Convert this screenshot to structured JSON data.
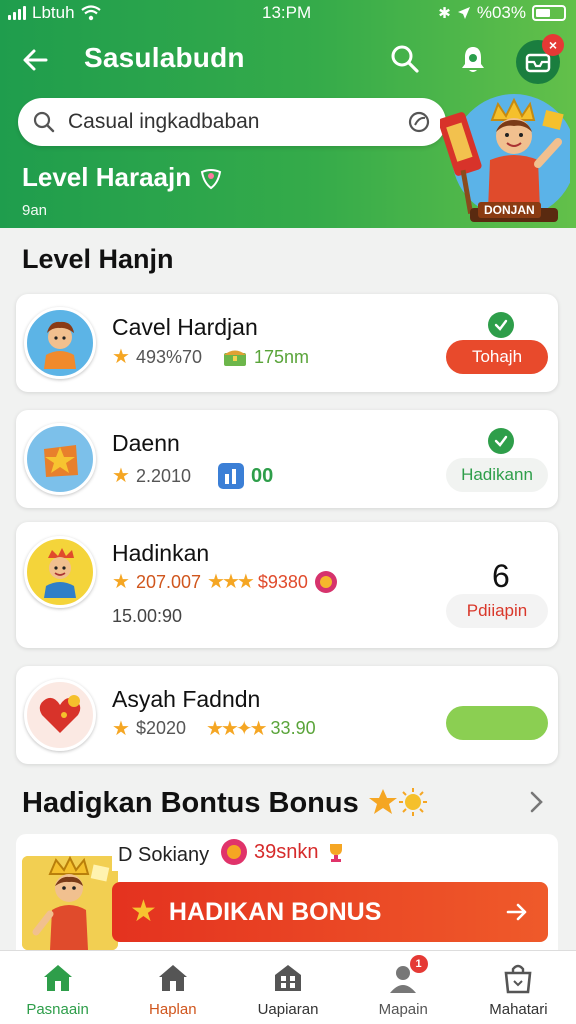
{
  "status_bar": {
    "carrier": "Lbtuh",
    "time": "13:PM",
    "battery": "%03%"
  },
  "header": {
    "title": "Sasulabudn",
    "search_placeholder": "Casual ingkadbaban",
    "hero_level": "Level Haraajn",
    "hero_sub": "9an",
    "mascot_label": "DONJAN"
  },
  "list": {
    "title": "Level Hanjn",
    "items": [
      {
        "name": "Cavel Hardjan",
        "stat1": "493%70",
        "stat2": "175nm",
        "action": "Tohajh",
        "completed": true
      },
      {
        "name": "Daenn",
        "stat1": "2.2010",
        "stat2": "00",
        "action": "Hadikann",
        "completed": true
      },
      {
        "name": "Hadinkan",
        "count": "6",
        "stat1": "207.007",
        "stat2": "$9380",
        "stat3": "15.00:90",
        "action": "Pdiiapin",
        "completed": false
      },
      {
        "name": "Asyah Fadndn",
        "stat1": "$2020",
        "stat2": "33.90",
        "action": "",
        "completed": false
      }
    ]
  },
  "bonus": {
    "title": "Hadigkan Bontus Bonus",
    "tag": "D Sokiany",
    "points": "39snkn",
    "button_label": "HADIKAN BONUS"
  },
  "tabbar": {
    "items": [
      {
        "label": "Pasnaain",
        "icon": "home-icon",
        "active": true
      },
      {
        "label": "Haplan",
        "icon": "house-icon",
        "active": false
      },
      {
        "label": "Uapiaran",
        "icon": "building-icon",
        "active": false
      },
      {
        "label": "Mapain",
        "icon": "profile-icon",
        "active": false,
        "badge": "1"
      },
      {
        "label": "Mahatari",
        "icon": "bag-icon",
        "active": false
      }
    ]
  },
  "colors": {
    "primary_green": "#2e9e4a",
    "header_gradient_start": "#1f9d4d",
    "header_gradient_end": "#63c04a",
    "accent_red": "#e4321f",
    "accent_orange": "#ef5a2a",
    "star": "#f5a623"
  }
}
